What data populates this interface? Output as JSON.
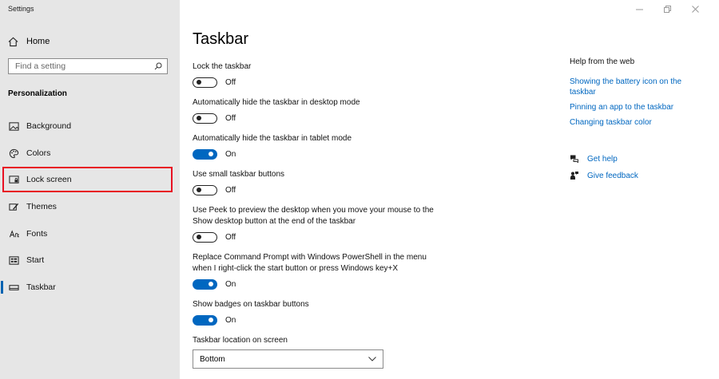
{
  "window": {
    "title": "Settings"
  },
  "sidebar": {
    "home_label": "Home",
    "search_placeholder": "Find a setting",
    "section_title": "Personalization",
    "items": [
      {
        "label": "Background",
        "icon": "picture-icon"
      },
      {
        "label": "Colors",
        "icon": "palette-icon"
      },
      {
        "label": "Lock screen",
        "icon": "lock-screen-icon"
      },
      {
        "label": "Themes",
        "icon": "brush-icon"
      },
      {
        "label": "Fonts",
        "icon": "font-icon"
      },
      {
        "label": "Start",
        "icon": "start-icon"
      },
      {
        "label": "Taskbar",
        "icon": "taskbar-icon"
      }
    ],
    "selected_item": "Taskbar",
    "highlighted_item": "Lock screen",
    "highlight_color": "#e81123"
  },
  "main": {
    "title": "Taskbar",
    "settings": [
      {
        "label": "Lock the taskbar",
        "state": "Off",
        "on": false
      },
      {
        "label": "Automatically hide the taskbar in desktop mode",
        "state": "Off",
        "on": false
      },
      {
        "label": "Automatically hide the taskbar in tablet mode",
        "state": "On",
        "on": true
      },
      {
        "label": "Use small taskbar buttons",
        "state": "Off",
        "on": false
      },
      {
        "label": "Use Peek to preview the desktop when you move your mouse to the Show desktop button at the end of the taskbar",
        "state": "Off",
        "on": false
      },
      {
        "label": "Replace Command Prompt with Windows PowerShell in the menu when I right-click the start button or press Windows key+X",
        "state": "On",
        "on": true
      },
      {
        "label": "Show badges on taskbar buttons",
        "state": "On",
        "on": true
      }
    ],
    "location_label": "Taskbar location on screen",
    "location_value": "Bottom"
  },
  "help": {
    "title": "Help from the web",
    "links": [
      "Showing the battery icon on the taskbar",
      "Pinning an app to the taskbar",
      "Changing taskbar color"
    ],
    "get_help": "Get help",
    "give_feedback": "Give feedback"
  },
  "colors": {
    "accent": "#0067c0",
    "sidebar_bg": "#e6e6e6"
  }
}
